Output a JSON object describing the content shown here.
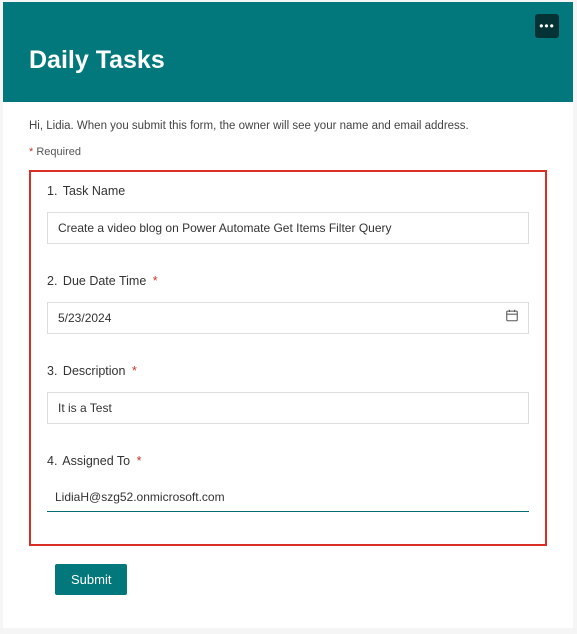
{
  "header": {
    "title": "Daily Tasks",
    "more_icon": "more-horizontal-icon"
  },
  "intro": "Hi, Lidia. When you submit this form, the owner will see your name and email address.",
  "required": {
    "asterisk": "*",
    "label": " Required"
  },
  "questions": {
    "task_name": {
      "num": "1.",
      "label": "Task Name",
      "required": false,
      "value": "Create a video blog on Power Automate Get Items Filter Query"
    },
    "due_date": {
      "num": "2.",
      "label": "Due Date Time",
      "required": true,
      "value": "5/23/2024"
    },
    "description": {
      "num": "3.",
      "label": "Description",
      "required": true,
      "value": "It is a Test"
    },
    "assigned_to": {
      "num": "4.",
      "label": "Assigned To",
      "required": true,
      "value": "LidiaH@szg52.onmicrosoft.com"
    }
  },
  "required_asterisk": "*",
  "submit_label": "Submit",
  "colors": {
    "brand": "#03787c",
    "error": "#d93025"
  }
}
